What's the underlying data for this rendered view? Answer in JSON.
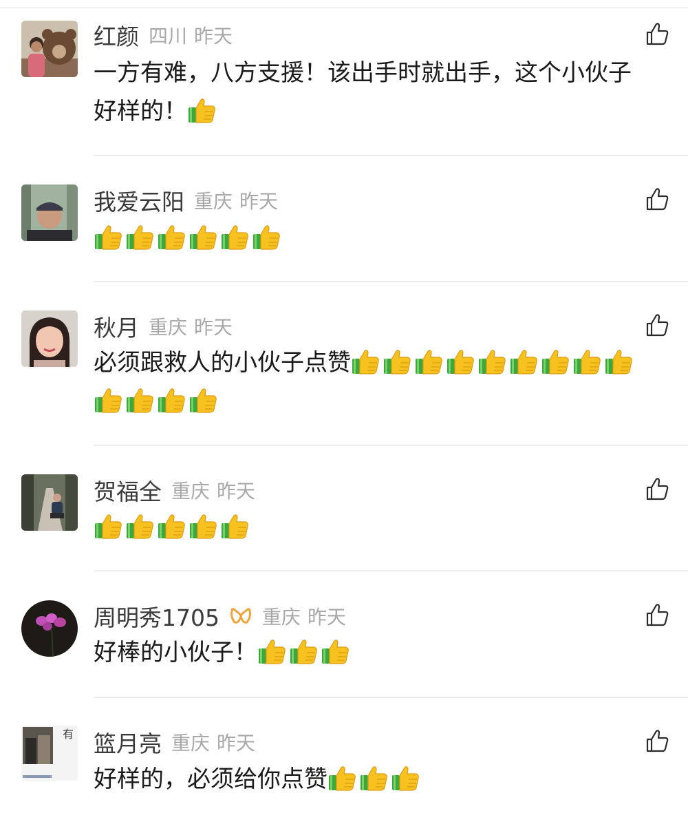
{
  "comments": [
    {
      "name": "红颜",
      "location": "四川",
      "time": "昨天",
      "text": "一方有难，八方支援！该出手时就出手，这个小伙子好样的！",
      "thumbs_after": 1,
      "avatar_icon": "avatar-photo-bear-icon"
    },
    {
      "name": "我爱云阳",
      "location": "重庆",
      "time": "昨天",
      "text": "",
      "thumbs_after": 6,
      "avatar_icon": "avatar-photo-man-icon"
    },
    {
      "name": "秋月",
      "location": "重庆",
      "time": "昨天",
      "text": "必须跟救人的小伙子点赞",
      "thumbs_after": 13,
      "avatar_icon": "avatar-photo-woman-icon"
    },
    {
      "name": "贺福全",
      "location": "重庆",
      "time": "昨天",
      "text": "",
      "thumbs_after": 5,
      "avatar_icon": "avatar-photo-park-icon"
    },
    {
      "name": "周明秀1705",
      "location": "重庆",
      "time": "昨天",
      "text": "好棒的小伙子！",
      "thumbs_after": 3,
      "avatar_icon": "avatar-orchid-icon",
      "badge": "orange-ribbon-badge-icon"
    },
    {
      "name": "篮月亮",
      "location": "重庆",
      "time": "昨天",
      "text": "好样的，必须给你点赞",
      "thumbs_after": 3,
      "avatar_icon": "avatar-photo-text-icon"
    }
  ],
  "icons": {
    "like": "thumbs-up-outline-icon",
    "emoji": "thumbs-up-emoji-icon"
  },
  "colors": {
    "name": "#3a3a3a",
    "meta": "#a8a8a8",
    "text": "#1a1a1a",
    "divider": "#ededed",
    "badge": "#f0a23b"
  }
}
